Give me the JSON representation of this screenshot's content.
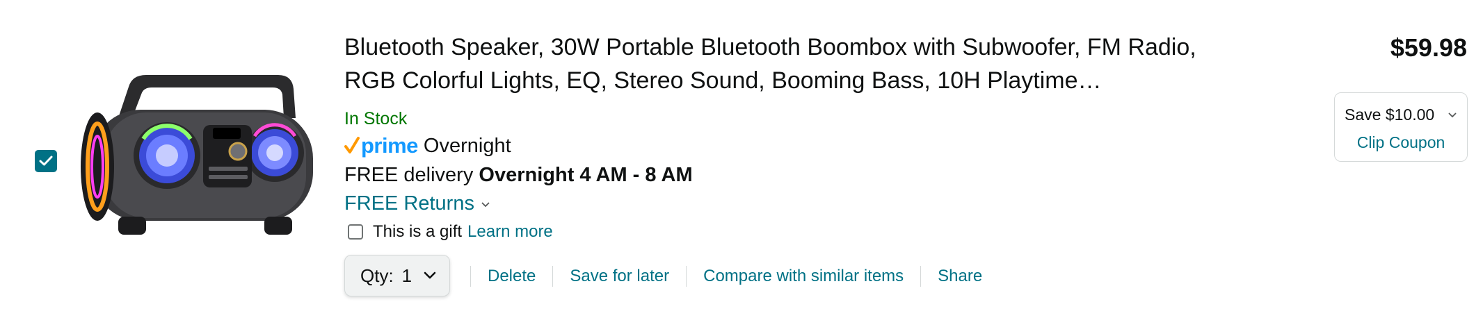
{
  "product": {
    "title": "Bluetooth Speaker, 30W Portable Bluetooth Boombox with Subwoofer, FM Radio, RGB Colorful Lights, EQ, Stereo Sound, Booming Bass, 10H Playtime…",
    "image_alt": "Bluetooth speaker boombox",
    "stock": "In Stock",
    "prime_label": "prime",
    "prime_type": "Overnight",
    "delivery_prefix": "FREE delivery",
    "delivery_window": "Overnight 4 AM - 8 AM",
    "returns_label": "FREE Returns",
    "gift_label": "This is a gift",
    "gift_link": "Learn more",
    "price": "$59.98"
  },
  "quantity": {
    "label": "Qty:",
    "value": "1"
  },
  "actions": {
    "delete": "Delete",
    "save_for_later": "Save for later",
    "compare": "Compare with similar items",
    "share": "Share"
  },
  "coupon": {
    "save_label": "Save $10.00",
    "clip_label": "Clip Coupon"
  },
  "selection": {
    "checked": true
  },
  "colors": {
    "link": "#007185",
    "in_stock": "#007600",
    "prime_blue": "#1399ff",
    "prime_check": "#ff9900",
    "checkbox": "#007185"
  },
  "icons": [
    "check-icon",
    "prime-check-icon",
    "chevron-down-icon"
  ]
}
